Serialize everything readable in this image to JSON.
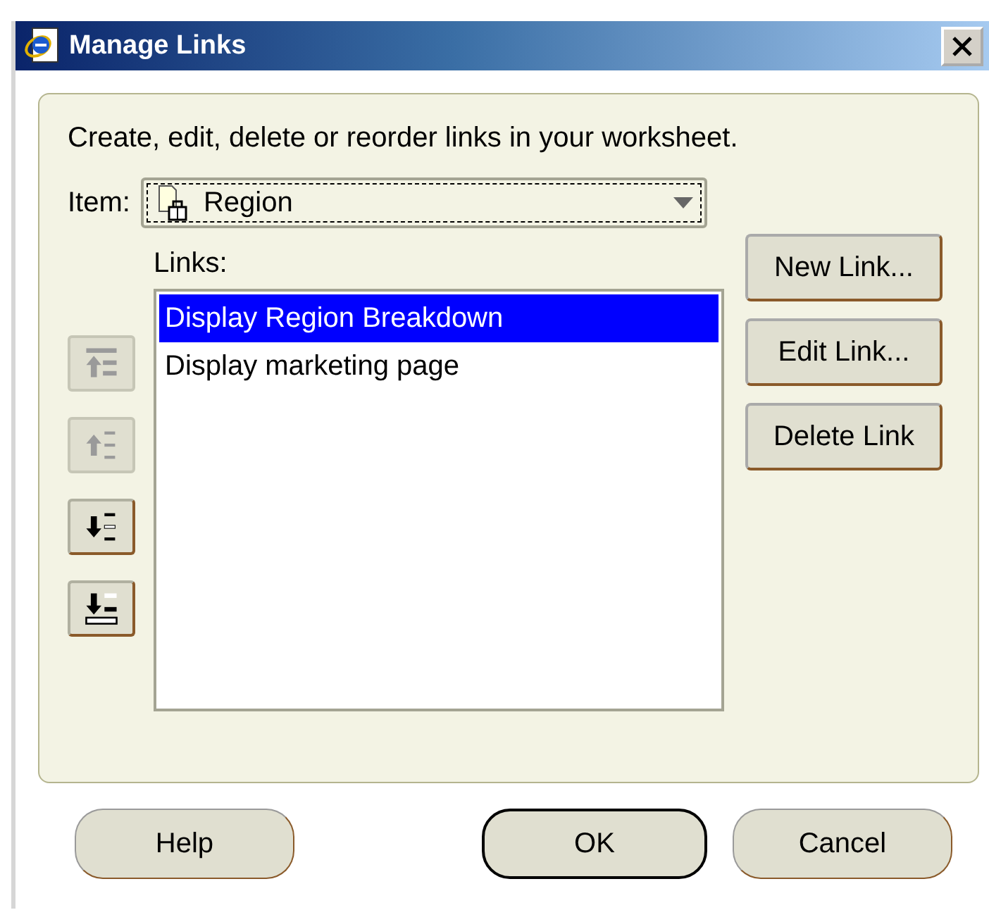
{
  "window": {
    "title": "Manage Links"
  },
  "description": "Create, edit, delete or reorder links in your worksheet.",
  "item": {
    "label": "Item:",
    "value": "Region"
  },
  "links": {
    "label": "Links:",
    "items": [
      {
        "text": "Display Region Breakdown",
        "selected": true
      },
      {
        "text": "Display marketing page",
        "selected": false
      }
    ]
  },
  "move_buttons": [
    {
      "kind": "top",
      "disabled": true
    },
    {
      "kind": "up",
      "disabled": true
    },
    {
      "kind": "down",
      "disabled": false
    },
    {
      "kind": "bottom",
      "disabled": false
    }
  ],
  "link_buttons": [
    "New Link...",
    "Edit Link...",
    "Delete Link"
  ],
  "footer_buttons": [
    {
      "label": "Help",
      "default": false
    },
    {
      "label": "OK",
      "default": true
    },
    {
      "label": "Cancel",
      "default": false
    }
  ]
}
